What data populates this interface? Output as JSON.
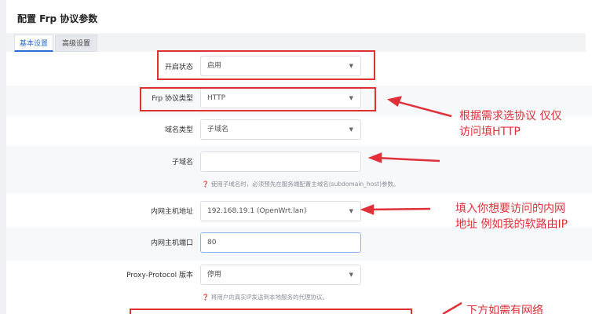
{
  "header": {
    "title": "配置 Frp 协议参数"
  },
  "tabs": [
    {
      "label": "基本设置"
    },
    {
      "label": "高级设置"
    }
  ],
  "form": {
    "enable_status": {
      "label": "开启状态",
      "value": "启用"
    },
    "frp_protocol": {
      "label": "Frp 协议类型",
      "value": "HTTP"
    },
    "domain_type": {
      "label": "域名类型",
      "value": "子域名"
    },
    "subdomain": {
      "label": "子域名",
      "value": "",
      "hint": "使用子域名时，必须预先在服务端配置主域名(subdomain_host)参数。"
    },
    "local_ip": {
      "label": "内网主机地址",
      "value": "192.168.19.1 (OpenWrt.lan)"
    },
    "local_port": {
      "label": "内网主机端口",
      "value": "80"
    },
    "proxy_protocol": {
      "label": "Proxy-Protocol 版本",
      "value": "停用",
      "hint": "将用户的真实IP发送到本地服务的代理协议。"
    }
  },
  "annotations": {
    "protocol_note_line1": "根据需求选协议 仅仅",
    "protocol_note_line2": "访问填HTTP",
    "ip_note_line1": "填入你想要访问的内网",
    "ip_note_line2": "地址  例如我的软路由IP",
    "bottom_note_partial": "下方如需有网络"
  },
  "colors": {
    "annotation_red": "#e0303a",
    "accent_blue": "#2d6fd6"
  }
}
